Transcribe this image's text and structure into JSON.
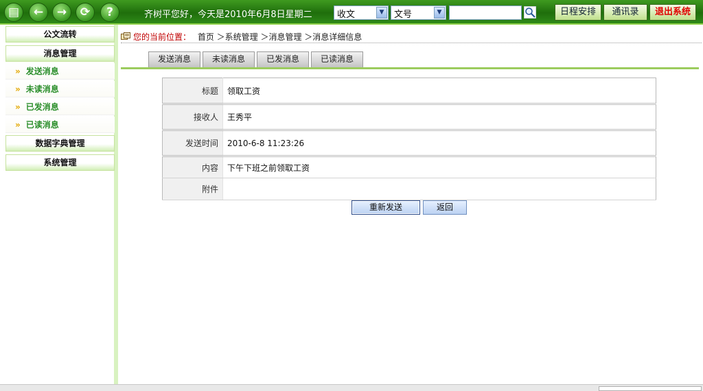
{
  "header": {
    "welcome": "齐树平您好，今天是2010年6月8日星期二",
    "nav_icons": [
      "document-icon",
      "back-arrow-icon",
      "forward-arrow-icon",
      "refresh-icon",
      "help-icon"
    ],
    "select_type": "收文",
    "select_field": "文号",
    "search_value": "",
    "buttons": {
      "schedule": "日程安排",
      "contacts": "通讯录",
      "logout": "退出系统"
    }
  },
  "sidebar": {
    "sections": [
      {
        "label": "公文流转"
      },
      {
        "label": "消息管理"
      }
    ],
    "items": [
      {
        "label": "发送消息"
      },
      {
        "label": "未读消息"
      },
      {
        "label": "已发消息"
      },
      {
        "label": "已读消息"
      }
    ],
    "sections_bottom": [
      {
        "label": "数据字典管理"
      },
      {
        "label": "系统管理"
      }
    ]
  },
  "breadcrumb": {
    "prefix": "您的当前位置：",
    "path": "首页 ＞系统管理 ＞消息管理 ＞消息详细信息"
  },
  "tabs": [
    {
      "label": "发送消息"
    },
    {
      "label": "未读消息"
    },
    {
      "label": "已发消息"
    },
    {
      "label": "已读消息"
    }
  ],
  "detail": {
    "title_label": "标题",
    "title_value": "领取工资",
    "receiver_label": "接收人",
    "receiver_value": "王秀平",
    "time_label": "发送时间",
    "time_value": "2010-6-8 11:23:26",
    "content_label": "内容",
    "content_value": "下午下班之前领取工资",
    "attachment_label": "附件",
    "attachment_value": ""
  },
  "actions": {
    "resend": "重新发送",
    "back": "返回"
  },
  "colors": {
    "topbar": "#2f8a18",
    "accent_green": "#9ccc5e",
    "exit_red": "#e00000",
    "menu_item_green": "#2c8f2c"
  }
}
